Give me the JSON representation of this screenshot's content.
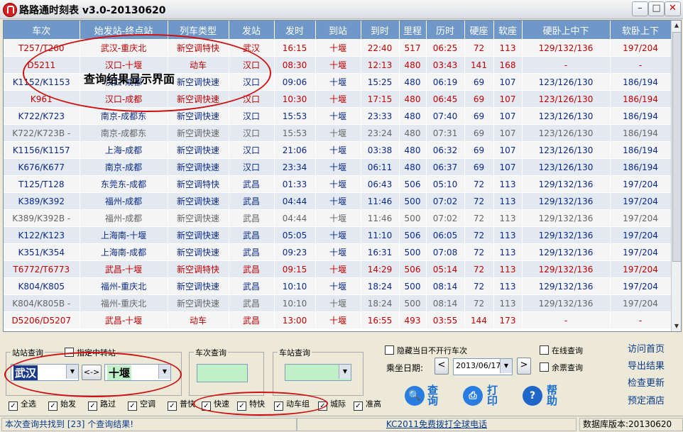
{
  "window": {
    "title": "路路通时刻表 v3.0-20130620",
    "min": "–",
    "max": "□",
    "close": "✕"
  },
  "columns": [
    "车次",
    "始发站-终点站",
    "列车类型",
    "发站",
    "发时",
    "到站",
    "到时",
    "里程",
    "历时",
    "硬座",
    "软座",
    "硬卧上中下",
    "软卧上下"
  ],
  "rows": [
    {
      "style": "red",
      "cells": [
        "T257/T260",
        "武汉-重庆北",
        "新空调特快",
        "武汉",
        "16:15",
        "十堰",
        "22:40",
        "517",
        "06:25",
        "72",
        "113",
        "129/132/136",
        "197/204"
      ]
    },
    {
      "style": "red",
      "cells": [
        "D5211",
        "汉口-十堰",
        "动车",
        "汉口",
        "08:30",
        "十堰",
        "12:13",
        "480",
        "03:43",
        "141",
        "168",
        "-",
        "-"
      ]
    },
    {
      "style": "blue",
      "cells": [
        "K1152/K1153",
        "汉口-成都",
        "新空调快速",
        "汉口",
        "09:06",
        "十堰",
        "15:25",
        "480",
        "06:19",
        "69",
        "107",
        "123/126/130",
        "186/194"
      ]
    },
    {
      "style": "red",
      "cells": [
        "K961",
        "汉口-成都",
        "新空调快速",
        "汉口",
        "10:30",
        "十堰",
        "17:15",
        "480",
        "06:45",
        "69",
        "107",
        "123/126/130",
        "186/194"
      ]
    },
    {
      "style": "blue",
      "cells": [
        "K722/K723",
        "南京-成都东",
        "新空调快速",
        "汉口",
        "15:53",
        "十堰",
        "23:33",
        "480",
        "07:40",
        "69",
        "107",
        "123/126/130",
        "186/194"
      ]
    },
    {
      "style": "gray",
      "cells": [
        "K722/K723B -",
        "南京-成都东",
        "新空调快速",
        "汉口",
        "15:53",
        "十堰",
        "23:24",
        "480",
        "07:31",
        "69",
        "107",
        "123/126/130",
        "186/194"
      ]
    },
    {
      "style": "blue",
      "cells": [
        "K1156/K1157",
        "上海-成都",
        "新空调快速",
        "汉口",
        "21:06",
        "十堰",
        "03:38",
        "480",
        "06:32",
        "69",
        "107",
        "123/126/130",
        "186/194"
      ]
    },
    {
      "style": "blue",
      "cells": [
        "K676/K677",
        "南京-成都",
        "新空调快速",
        "汉口",
        "23:34",
        "十堰",
        "06:11",
        "480",
        "06:37",
        "69",
        "107",
        "123/126/130",
        "186/194"
      ]
    },
    {
      "style": "blue",
      "cells": [
        "T125/T128",
        "东莞东-成都",
        "新空调特快",
        "武昌",
        "01:33",
        "十堰",
        "06:43",
        "506",
        "05:10",
        "72",
        "113",
        "129/132/136",
        "197/204"
      ]
    },
    {
      "style": "blue",
      "cells": [
        "K389/K392",
        "福州-成都",
        "新空调快速",
        "武昌",
        "04:44",
        "十堰",
        "11:46",
        "500",
        "07:02",
        "72",
        "113",
        "129/132/136",
        "197/204"
      ]
    },
    {
      "style": "gray",
      "cells": [
        "K389/K392B -",
        "福州-成都",
        "新空调快速",
        "武昌",
        "04:44",
        "十堰",
        "11:46",
        "500",
        "07:02",
        "72",
        "113",
        "129/132/136",
        "197/204"
      ]
    },
    {
      "style": "blue",
      "cells": [
        "K122/K123",
        "上海南-十堰",
        "新空调快速",
        "武昌",
        "05:05",
        "十堰",
        "11:10",
        "506",
        "06:05",
        "72",
        "113",
        "129/132/136",
        "197/204"
      ]
    },
    {
      "style": "blue",
      "cells": [
        "K351/K354",
        "上海南-成都",
        "新空调快速",
        "武昌",
        "09:23",
        "十堰",
        "16:31",
        "500",
        "07:08",
        "72",
        "113",
        "129/132/136",
        "197/204"
      ]
    },
    {
      "style": "red",
      "cells": [
        "T6772/T6773",
        "武昌-十堰",
        "新空调特快",
        "武昌",
        "09:15",
        "十堰",
        "14:29",
        "506",
        "05:14",
        "72",
        "113",
        "129/132/136",
        "197/204"
      ]
    },
    {
      "style": "blue",
      "cells": [
        "K804/K805",
        "福州-重庆北",
        "新空调快速",
        "武昌",
        "10:10",
        "十堰",
        "18:24",
        "500",
        "08:14",
        "72",
        "113",
        "129/132/136",
        "197/204"
      ]
    },
    {
      "style": "gray",
      "cells": [
        "K804/K805B -",
        "福州-重庆北",
        "新空调快速",
        "武昌",
        "10:10",
        "十堰",
        "18:24",
        "500",
        "08:14",
        "72",
        "113",
        "129/132/136",
        "197/204"
      ]
    },
    {
      "style": "red",
      "cells": [
        "D5206/D5207",
        "武昌-十堰",
        "动车",
        "武昌",
        "13:00",
        "十堰",
        "16:55",
        "493",
        "03:55",
        "144",
        "173",
        "-",
        "-"
      ]
    }
  ],
  "annotation": "查询结果显示界面",
  "station_query": {
    "legend": "站站查询",
    "transfer_label": "指定中转站",
    "from": "武汉",
    "swap": "<->",
    "to": "十堰"
  },
  "train_query": {
    "legend": "车次查询"
  },
  "station2_query": {
    "legend": "车站查询"
  },
  "hide_label": "隐藏当日不开行车次",
  "date": {
    "label": "乘坐日期:",
    "value": "2013/06/17",
    "prev": "<",
    "next": ">"
  },
  "online_label": "在线查询",
  "ticket_label": "余票查询",
  "actions": {
    "query": "查询",
    "print": "打印",
    "help": "帮助"
  },
  "links": [
    "访问首页",
    "导出结果",
    "检查更新",
    "预定酒店"
  ],
  "filters": [
    "全选",
    "始发",
    "路过",
    "空调",
    "普快",
    "快速",
    "特快",
    "动车组",
    "城际",
    "准高"
  ],
  "status": {
    "left": "本次查询共找到 [23] 个查询结果!",
    "middle": "KC2011免费拨打全球电话",
    "right": "数据库版本:20130620"
  },
  "colors": {
    "header": "#6f98c8",
    "red_text": "#c00000",
    "blue_text": "#0a2a8a",
    "ellipse": "#d01010"
  }
}
